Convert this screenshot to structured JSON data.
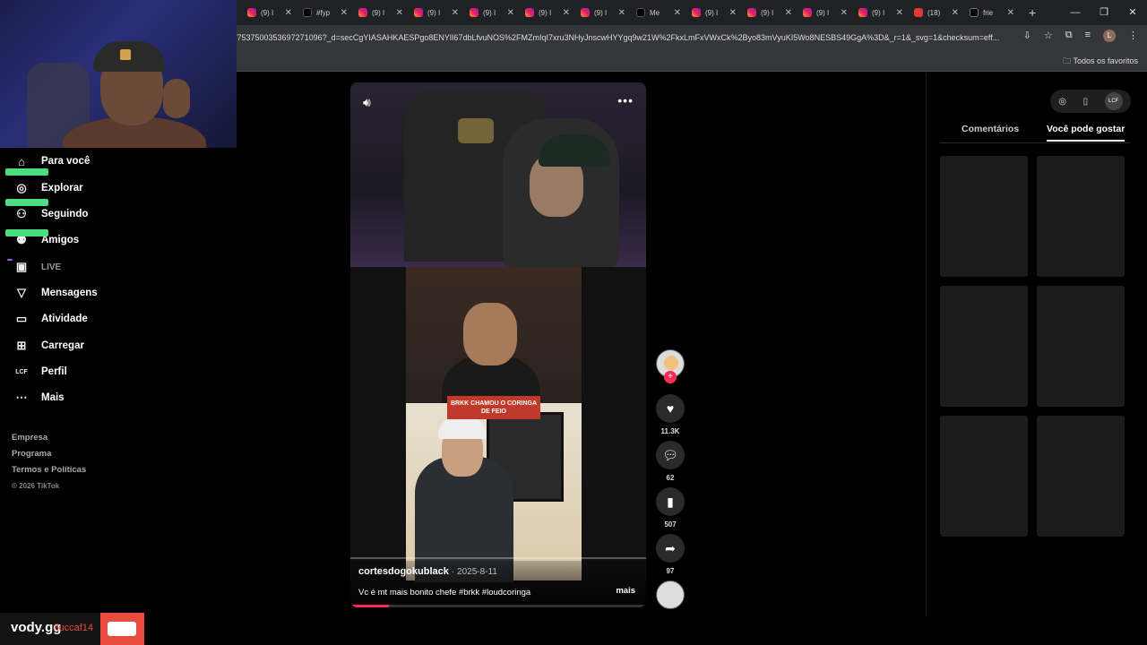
{
  "browser": {
    "tabs": [
      {
        "title": "(9) I",
        "favicon": "instagram-icon"
      },
      {
        "title": "#fyp",
        "favicon": "tiktok-icon"
      },
      {
        "title": "(9) I",
        "favicon": "instagram-icon"
      },
      {
        "title": "(9) I",
        "favicon": "instagram-icon"
      },
      {
        "title": "(9) I",
        "favicon": "instagram-icon"
      },
      {
        "title": "(9) I",
        "favicon": "instagram-icon"
      },
      {
        "title": "(9) I",
        "favicon": "instagram-icon"
      },
      {
        "title": "Me",
        "favicon": "tiktok-icon"
      },
      {
        "title": "(9) I",
        "favicon": "instagram-icon"
      },
      {
        "title": "(9) I",
        "favicon": "instagram-icon"
      },
      {
        "title": "(9) I",
        "favicon": "instagram-icon"
      },
      {
        "title": "(9) I",
        "favicon": "instagram-icon"
      },
      {
        "title": "(18)",
        "favicon": "youtube-icon"
      },
      {
        "title": "frie",
        "favicon": "x-icon"
      }
    ],
    "url": "/7537500353697271096?_d=secCgYIASAHKAESPgo8ENYlI67dbLfvuNOS%2FMZmIqI7xru3NHyJnscwHYYgq9w21W%2FkxLmFxVWxCk%2Byo83mVyuKI5Wo8NESBS49GgA%3D&_r=1&_svg=1&checksum=eff...",
    "bookmarks_folder": "Todos os favoritos",
    "profile_initial": "L"
  },
  "sidebar": {
    "items": [
      {
        "label": "Para você",
        "icon": "home-icon"
      },
      {
        "label": "Explorar",
        "icon": "compass-icon"
      },
      {
        "label": "Seguindo",
        "icon": "following-icon"
      },
      {
        "label": "Amigos",
        "icon": "friends-icon"
      },
      {
        "label": "LIVE",
        "icon": "live-icon"
      },
      {
        "label": "Mensagens",
        "icon": "messages-icon"
      },
      {
        "label": "Atividade",
        "icon": "activity-icon"
      },
      {
        "label": "Carregar",
        "icon": "upload-icon"
      },
      {
        "label": "Perfil",
        "icon": "profile-icon"
      },
      {
        "label": "Mais",
        "icon": "more-icon"
      }
    ],
    "footer": [
      "Empresa",
      "Programa",
      "Termos e Políticas"
    ],
    "copyright": "© 2026 TikTok"
  },
  "video": {
    "author": "cortesdogokublack",
    "date": "· 2025-8-11",
    "description": "Vc é mt mais bonito chefe #brkk #loudcoringa",
    "more_label": "mais",
    "caption_overlay": "BRKK CHAMOU O CORINGA DE FEIO",
    "stats": {
      "likes": "11.3K",
      "comments": "62",
      "saves": "507",
      "shares": "97"
    }
  },
  "right_panel": {
    "tabs": [
      "Comentários",
      "Você pode gostar"
    ],
    "active_tab": "Você pode gostar",
    "avatar_text": "LCF"
  },
  "overlay": {
    "brand": "vody.gg",
    "handle": "/luccaf14"
  },
  "colors": {
    "accent": "#fe2c55",
    "background": "#000000"
  }
}
